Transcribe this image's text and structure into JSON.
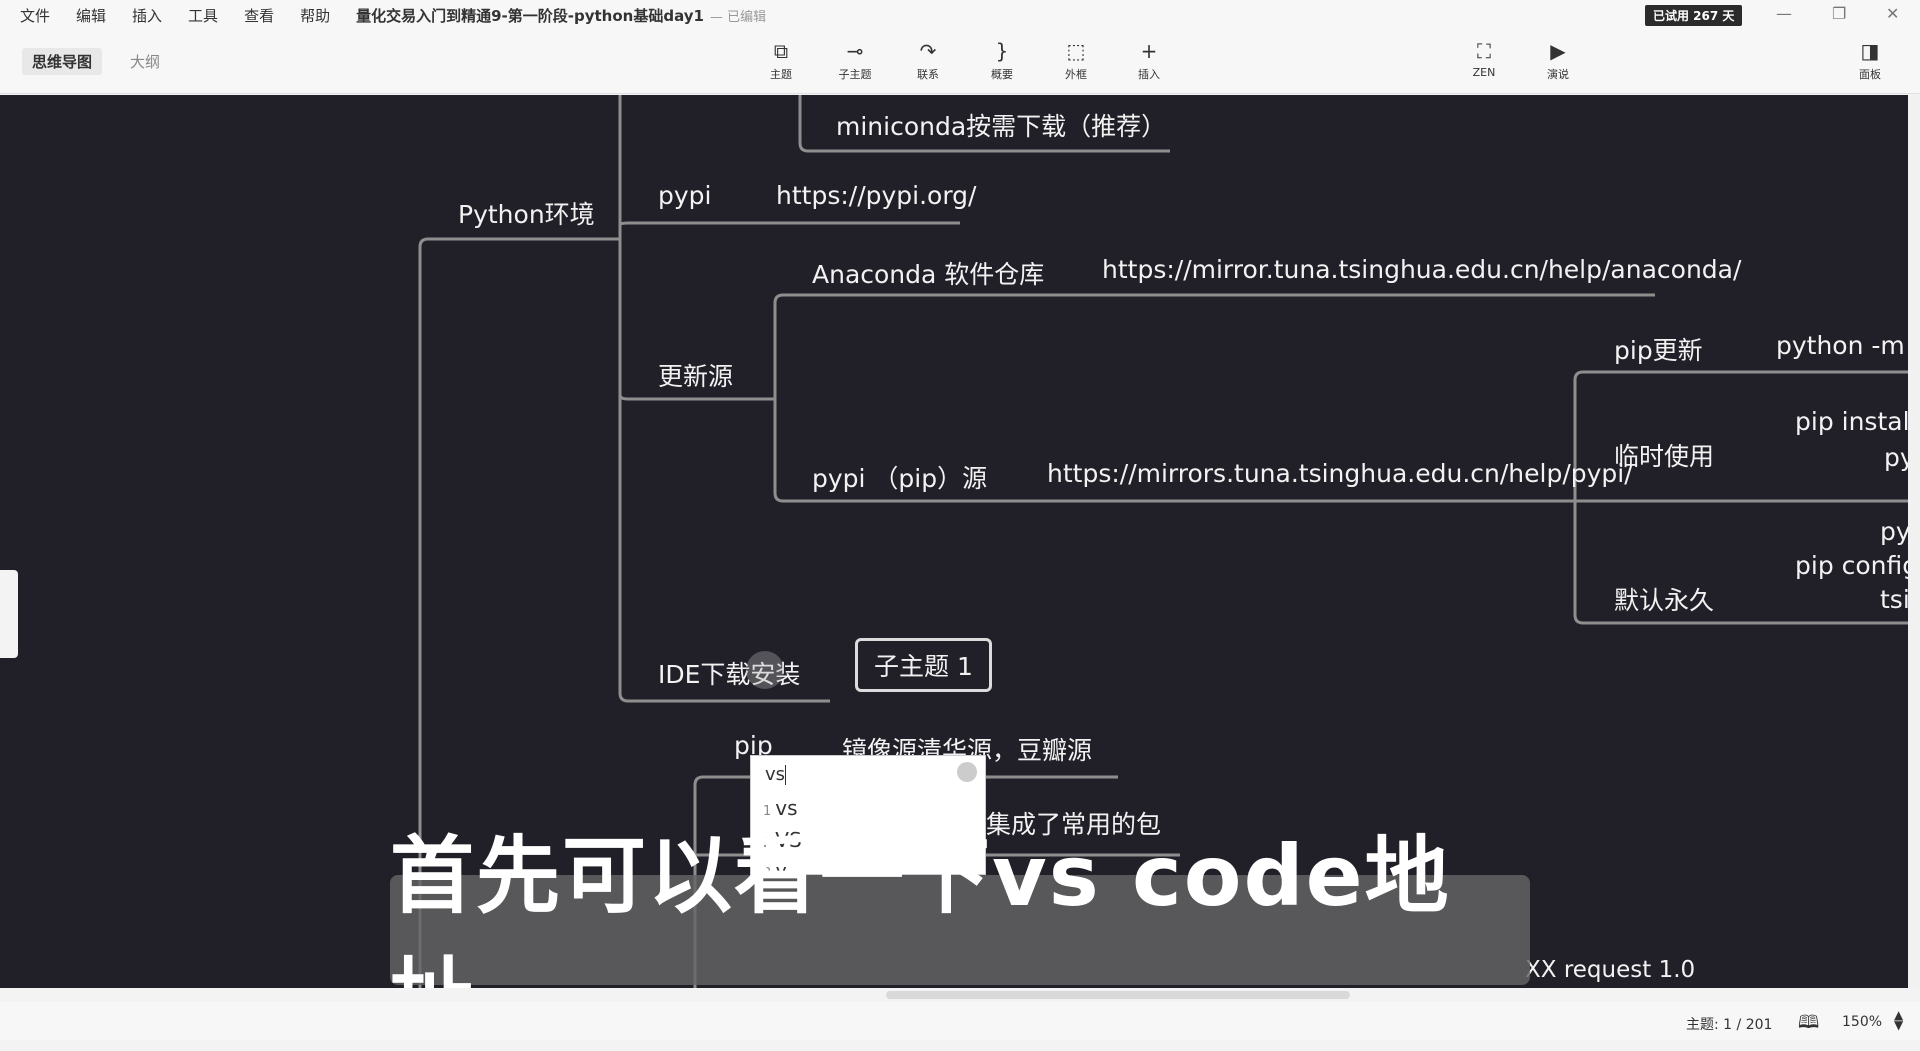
{
  "menu": {
    "items": [
      "文件",
      "编辑",
      "插入",
      "工具",
      "查看",
      "帮助"
    ],
    "doc_title": "量化交易入门到精通9-第一阶段-python基础day1",
    "doc_status": "— 已编辑",
    "trial_badge": "已试用 267 天"
  },
  "window_controls": {
    "minimize": "—",
    "restore": "❐",
    "close": "✕"
  },
  "view_tabs": {
    "mindmap": "思维导图",
    "outline": "大纲"
  },
  "toolbar": {
    "topic": "主题",
    "subtopic": "子主题",
    "relation": "联系",
    "summary": "概要",
    "boundary": "外框",
    "insert": "插入",
    "zen": "ZEN",
    "present": "演说",
    "panel": "面板"
  },
  "mindmap": {
    "python_env": "Python环境",
    "miniconda": "miniconda按需下载（推荐）",
    "pypi": "pypi",
    "pypi_url": "https://pypi.org/",
    "anaconda_repo": "Anaconda 软件仓库",
    "anaconda_url": "https://mirror.tuna.tsinghua.edu.cn/help/anaconda/",
    "update_source": "更新源",
    "pip_update": "pip更新",
    "pip_update_cmd": "python -m pi",
    "pip_install_cmd": "pip install -",
    "temp_use_py": "py",
    "temp_use": "临时使用",
    "pypi_pip_source": "pypi （pip）源",
    "pypi_mirror_url": "https://mirrors.tuna.tsinghua.edu.cn/help/pypi/",
    "default_py": "py",
    "pip_config": "pip config s",
    "default_tsi": "tsi",
    "default_permanent": "默认永久",
    "ide_install": "IDE下载安装",
    "subtopic1": "子主题 1",
    "pip": "pip",
    "mirror_sources": "镜像源清华源，豆瓣源",
    "common_packages": "集成了常用的包",
    "xx_request": "XX request 1.0"
  },
  "ime": {
    "input": "vs",
    "candidates": [
      {
        "num": "1",
        "text": "vs"
      },
      {
        "num": "2",
        "text": "VS"
      },
      {
        "num": "3",
        "text": "v"
      }
    ]
  },
  "subtitle": "首先可以看一下vs code地址",
  "status": {
    "topic_count": "主题: 1 / 201",
    "zoom": "150%"
  },
  "colors": {
    "canvas_bg": "#212028",
    "branch_line": "#8e8e8e",
    "node_text": "#f2f2f2"
  }
}
